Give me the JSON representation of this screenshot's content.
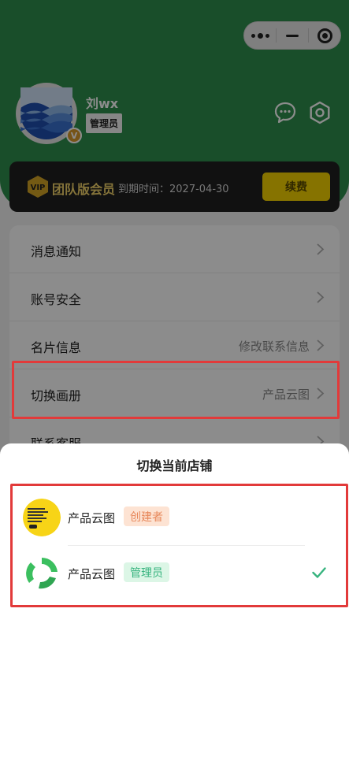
{
  "header": {
    "username": "刘wx",
    "role": "管理员",
    "avatar_badge": "V",
    "icons": [
      "more-dots-icon",
      "minimize-icon",
      "target-icon",
      "chat-icon",
      "settings-icon"
    ]
  },
  "vip": {
    "icon_text": "VIP",
    "title": "团队版会员",
    "expire": "到期时间：2027-04-30",
    "renew_label": "续费"
  },
  "menu": {
    "items": [
      {
        "label": "消息通知",
        "value": ""
      },
      {
        "label": "账号安全",
        "value": ""
      },
      {
        "label": "名片信息",
        "value": "修改联系信息"
      },
      {
        "label": "切换画册",
        "value": "产品云图"
      },
      {
        "label": "联系客服",
        "value": ""
      }
    ]
  },
  "sheet": {
    "title": "切换当前店铺",
    "stores": [
      {
        "name": "产品云图",
        "tag": "创建者",
        "selected": false
      },
      {
        "name": "产品云图",
        "tag": "管理员",
        "selected": true
      }
    ]
  },
  "colors": {
    "header_green": "#2f8f4d",
    "vip_gold": "#f5d100",
    "highlight_red": "#e23a3a",
    "check_green": "#36b37e"
  }
}
